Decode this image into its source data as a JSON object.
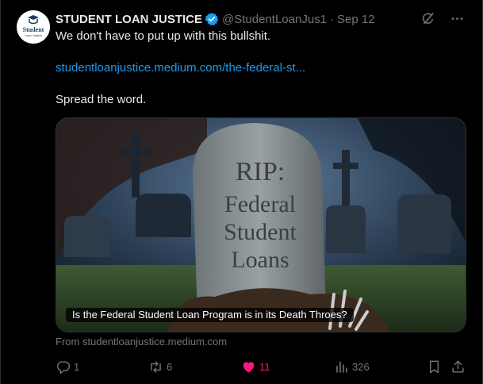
{
  "tweet": {
    "author_name": "STUDENT LOAN JUSTICE",
    "handle": "@StudentLoanJus1",
    "separator": "·",
    "date": "Sep 12",
    "text_line1": "We don't have to put up with this bullshit.",
    "link": "studentloanjustice.medium.com/the-federal-st...",
    "text_line2": "Spread the word."
  },
  "avatar": {
    "line1": "Student",
    "line2": "Loan Justice"
  },
  "card": {
    "caption": "Is the Federal Student Loan Program is in its Death Throes?",
    "from": "From studentloanjustice.medium.com",
    "tombstone": {
      "line1": "RIP:",
      "line2": "Federal",
      "line3": "Student",
      "line4": "Loans"
    }
  },
  "actions": {
    "reply_count": "1",
    "retweet_count": "6",
    "like_count": "11",
    "view_count": "326"
  },
  "icons": {
    "verified": "verified-badge-icon",
    "grok": "grok-icon",
    "more": "more-icon",
    "reply": "reply-icon",
    "retweet": "retweet-icon",
    "like": "heart-icon",
    "views": "views-icon",
    "bookmark": "bookmark-icon",
    "share": "share-icon"
  },
  "colors": {
    "accent": "#1d9bf0",
    "like": "#f91880",
    "muted": "#71767b",
    "background": "#000000"
  }
}
